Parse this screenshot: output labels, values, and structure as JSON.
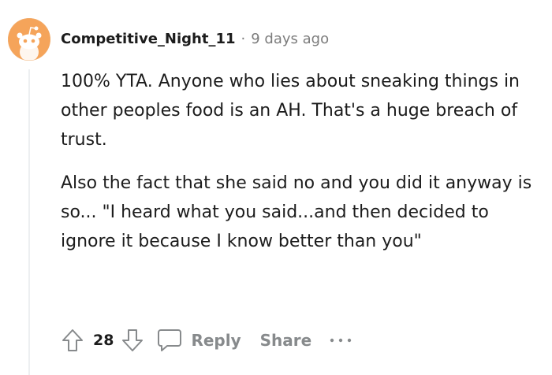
{
  "comment": {
    "username": "Competitive_Night_11",
    "separator": "·",
    "timestamp": "9 days ago",
    "paragraphs": [
      "100% YTA. Anyone who lies about sneaking things in other peoples food is an AH. That's a huge breach of trust.",
      "Also the fact that she said no and you did it anyway is so... \"I heard what you said...and then decided to ignore it because I know better than you\""
    ]
  },
  "actions": {
    "vote_count": "28",
    "reply_label": "Reply",
    "share_label": "Share"
  },
  "icons": {
    "avatar": "reddit-snoo-avatar-icon",
    "upvote": "upvote-arrow-icon",
    "downvote": "downvote-arrow-icon",
    "reply": "speech-bubble-icon",
    "more": "more-options-icon"
  },
  "colors": {
    "avatar_bg": "#f5a45a",
    "text": "#1c1c1c",
    "muted": "#7c7c7c",
    "action": "#878a8c",
    "thread_line": "#edeff1"
  }
}
